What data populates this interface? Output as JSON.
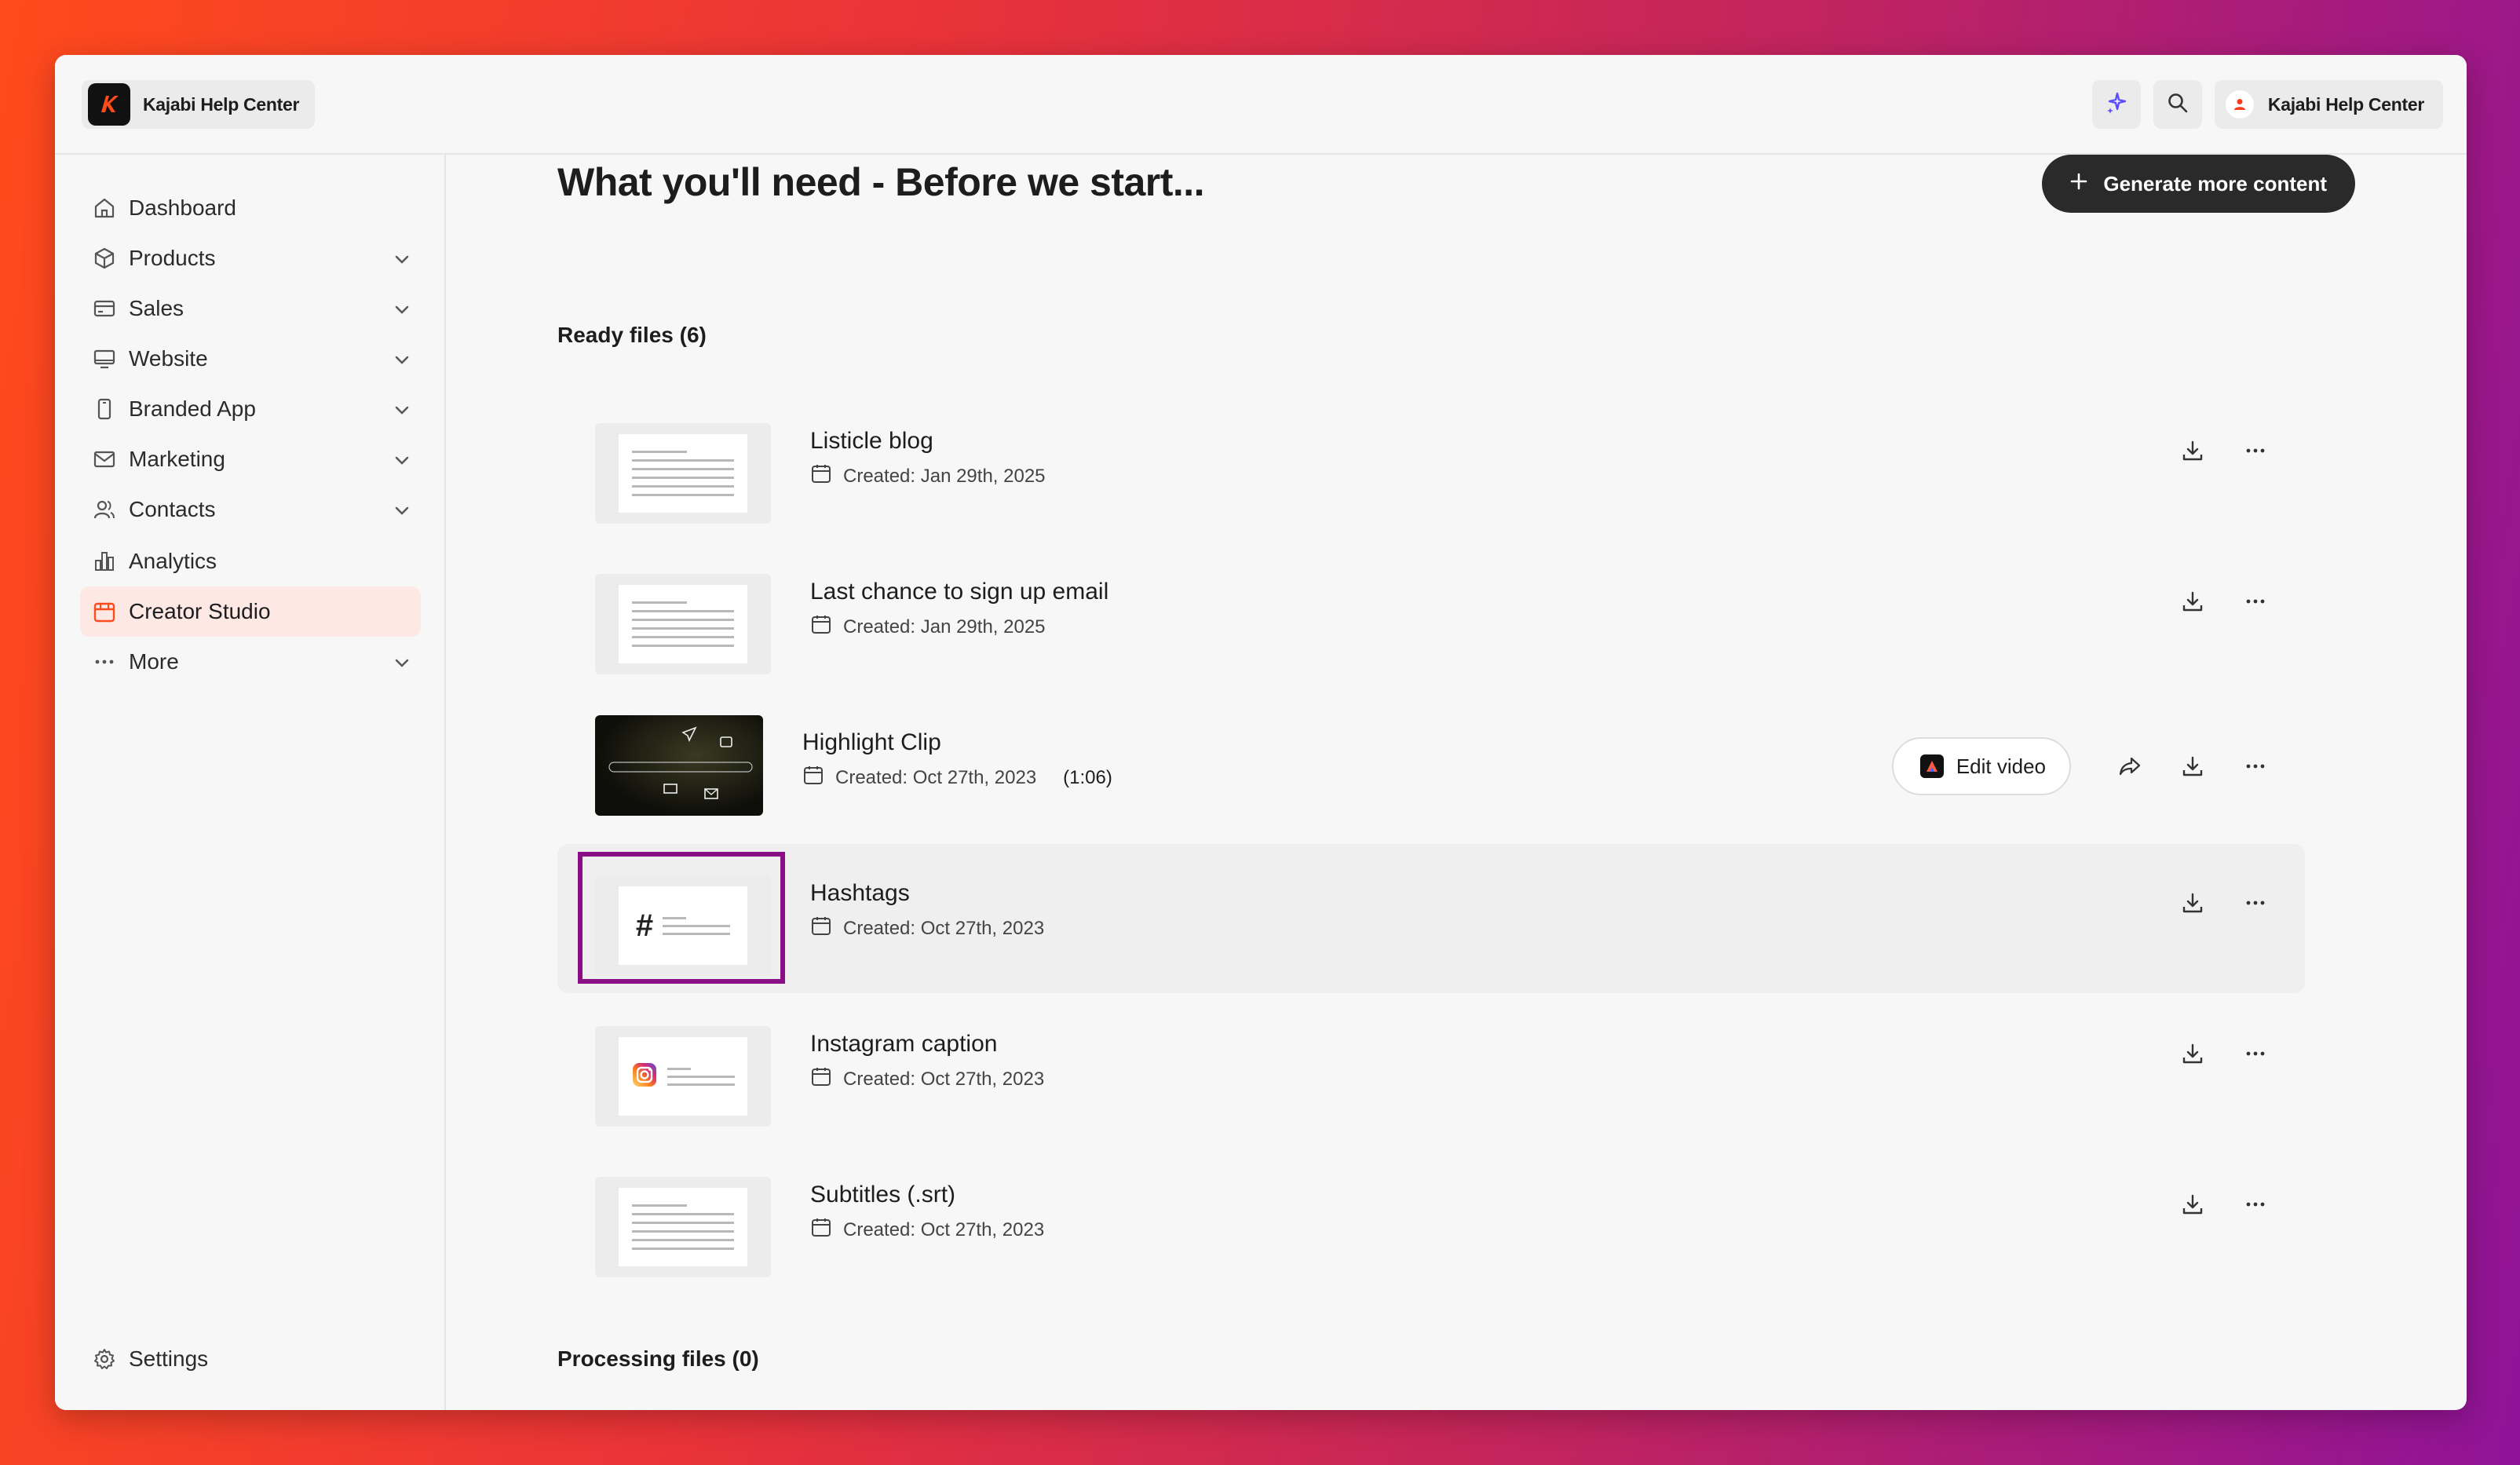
{
  "header": {
    "brand_name": "Kajabi Help Center",
    "account_name": "Kajabi Help Center",
    "icons": [
      "sparkle-icon",
      "search-icon",
      "user-icon"
    ]
  },
  "sidebar": {
    "items": [
      {
        "label": "Dashboard",
        "icon": "home-icon",
        "expandable": false
      },
      {
        "label": "Products",
        "icon": "cube-icon",
        "expandable": true
      },
      {
        "label": "Sales",
        "icon": "credit-card-icon",
        "expandable": true
      },
      {
        "label": "Website",
        "icon": "monitor-icon",
        "expandable": true
      },
      {
        "label": "Branded App",
        "icon": "phone-icon",
        "expandable": true
      },
      {
        "label": "Marketing",
        "icon": "mail-icon",
        "expandable": true
      },
      {
        "label": "Contacts",
        "icon": "users-icon",
        "expandable": true
      },
      {
        "label": "Analytics",
        "icon": "bar-chart-icon",
        "expandable": false
      },
      {
        "label": "Creator Studio",
        "icon": "calendar-icon",
        "expandable": false,
        "active": true
      },
      {
        "label": "More",
        "icon": "dots-icon",
        "expandable": true
      }
    ],
    "settings_label": "Settings"
  },
  "main": {
    "title": "What you'll need - Before we start...",
    "generate_button": "Generate more content",
    "ready_label": "Ready files (6)",
    "processing_label": "Processing files (0)",
    "files": [
      {
        "title": "Listicle blog",
        "created": "Created: Jan 29th, 2025",
        "thumb": "document"
      },
      {
        "title": "Last chance to sign up email",
        "created": "Created: Jan 29th, 2025",
        "thumb": "document"
      },
      {
        "title": "Highlight Clip",
        "created": "Created: Oct 27th, 2023",
        "duration": "(1:06)",
        "thumb": "video",
        "edit_label": "Edit video"
      },
      {
        "title": "Hashtags",
        "created": "Created: Oct 27th, 2023",
        "thumb": "hashtag",
        "highlighted": true
      },
      {
        "title": "Instagram caption",
        "created": "Created: Oct 27th, 2023",
        "thumb": "instagram"
      },
      {
        "title": "Subtitles (.srt)",
        "created": "Created: Oct 27th, 2023",
        "thumb": "document"
      }
    ]
  },
  "colors": {
    "active_nav_bg": "#fde8e4",
    "accent_orange": "#ff4a1c",
    "focus_outline": "#8a0f86",
    "primary_button": "#2a2a2a"
  }
}
